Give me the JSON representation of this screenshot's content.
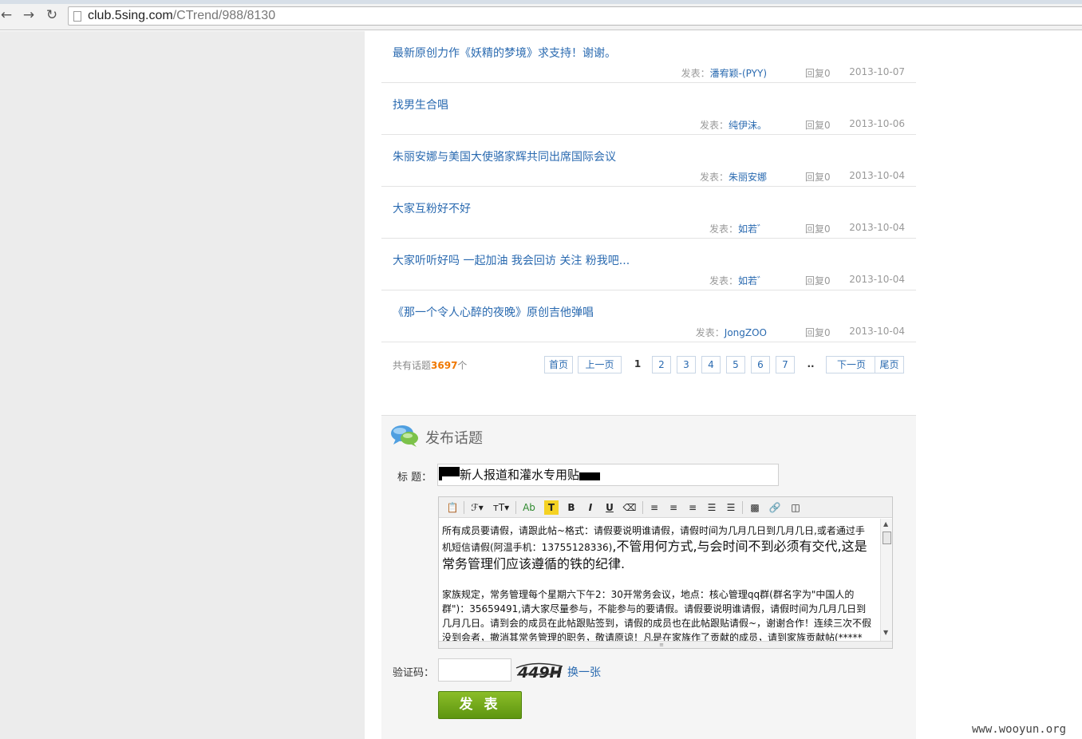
{
  "browser": {
    "url_host": "club.5sing.com",
    "url_path": "/CTrend/988/8130"
  },
  "topics": [
    {
      "title": "最新原创力作《妖精的梦境》求支持！谢谢。",
      "author_label": "发表：",
      "author": "潘宥颖-(PYY)",
      "replies": "回复0",
      "date": "2013-10-07"
    },
    {
      "title": "找男生合唱",
      "author_label": "发表：",
      "author": "纯伊沫。",
      "replies": "回复0",
      "date": "2013-10-06"
    },
    {
      "title": "朱丽安娜与美国大使骆家辉共同出席国际会议",
      "author_label": "发表：",
      "author": "朱丽安娜",
      "replies": "回复0",
      "date": "2013-10-04"
    },
    {
      "title": "大家互粉好不好",
      "author_label": "发表：",
      "author": "如若゛",
      "replies": "回复0",
      "date": "2013-10-04"
    },
    {
      "title": "大家听听好吗 一起加油 我会回访 关注 粉我吧...",
      "author_label": "发表：",
      "author": "如若゛",
      "replies": "回复0",
      "date": "2013-10-04"
    },
    {
      "title": "《那一个令人心醉的夜晚》原创吉他弹唱",
      "author_label": "发表：",
      "author": "JongZOO",
      "replies": "回复0",
      "date": "2013-10-04"
    }
  ],
  "pager": {
    "total_prefix": "共有话题",
    "total_count": "3697",
    "total_suffix": "个",
    "first": "首页",
    "prev": "上一页",
    "pages": [
      "1",
      "2",
      "3",
      "4",
      "5",
      "6",
      "7"
    ],
    "current": "1",
    "ellipsis": "..",
    "next": "下一页",
    "last": "尾页"
  },
  "post_form": {
    "header": "发布话题",
    "title_label": "标  题：",
    "title_value": "新人报道和灌水专用贴",
    "toolbar": {
      "font_family": "ℱ▾",
      "font_size": "ᴛT▾",
      "font_color": "Ab",
      "highlight": "T",
      "bold": "B",
      "italic": "I",
      "underline": "U"
    },
    "body_lines": [
      "所有成员要请假，请跟此帖~格式：请假要说明谁请假，请假时间为几月几日到几月几日,或者通过手",
      "机短信请假(阿温手机：13755128336)",
      ",不管用何方式,与会时间不到必须有交代,这是",
      "常务管理们应该遵循的铁的纪律.",
      "家族规定，常务管理每个星期六下午2：30开常务会议，地点：核心管理qq群(群名字为\"中国人的",
      "群\")：35659491,请大家尽量参与，不能参与的要请假。请假要说明谁请假，请假时间为几月几日到",
      "几月几日。请到会的成员在此帖跟贴签到，请假的成员也在此帖跟贴请假~，谢谢合作！连续三次不假",
      "没到会者，撤消其常务管理的职务，敬请原谅！凡是在家族作了贡献的成员，请到家族贡献帖(*****"
    ],
    "captcha_label": "验证码：",
    "captcha_text": "449H",
    "captcha_change": "换一张",
    "submit": "发 表"
  },
  "watermark": "www.wooyun.org",
  "colors": {
    "link": "#2a6ab0",
    "accent_count": "#f07800",
    "submit_green": "#6fa51a",
    "sidebar_gray": "#ececec"
  }
}
